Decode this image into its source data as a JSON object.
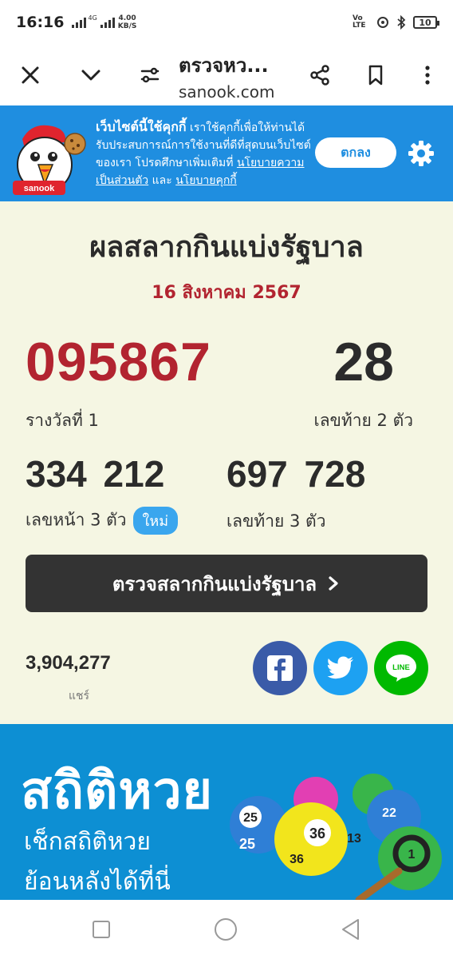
{
  "status": {
    "time": "16:16",
    "net_type": "4G",
    "speed_value": "4.00",
    "speed_unit": "KB/S",
    "volte": "Vo LTE",
    "battery": "10"
  },
  "browser": {
    "page_title": "ตรวจหว...",
    "host": "sanook.com"
  },
  "cookie": {
    "brand": "sanook",
    "lead": "เว็บไซต์นี้ใช้คุกกี้",
    "text": " เราใช้คุกกี้เพื่อให้ท่านได้รับประสบการณ์การใช้งานที่ดีที่สุดบนเว็บไซต์ของเรา โปรดศึกษาเพิ่มเติมที่ ",
    "privacy_link": "นโยบายความเป็นส่วนตัว",
    "and": " และ ",
    "cookie_link": "นโยบายคุกกี้",
    "accept_label": "ตกลง"
  },
  "lottery": {
    "title": "ผลสลากกินแบ่งรัฐบาล",
    "date": "16 สิงหาคม 2567",
    "first_prize": "095867",
    "first_prize_label": "รางวัลที่ 1",
    "last2": "28",
    "last2_label": "เลขท้าย 2 ตัว",
    "front3": "334 212",
    "front3_label": "เลขหน้า 3 ตัว",
    "new_badge": "ใหม่",
    "last3": "697 728",
    "last3_label": "เลขท้าย 3 ตัว",
    "check_button": "ตรวจสลากกินแบ่งรัฐบาล"
  },
  "share": {
    "count": "3,904,277",
    "label": "แชร์",
    "line_label": "LINE"
  },
  "stats_banner": {
    "title": "สถิติหวย",
    "line1": "เช็กสถิติหวย",
    "line2": "ย้อนหลังได้ที่นี่",
    "balls": [
      "25",
      "25",
      "36",
      "36",
      "13",
      "22",
      "1"
    ]
  },
  "colors": {
    "accent_red": "#b22430",
    "cookie_blue": "#1f8ee0",
    "facebook": "#3a5ba8",
    "twitter": "#1da1f2",
    "line": "#00b900",
    "stats_bg": "#0d8fd3"
  }
}
